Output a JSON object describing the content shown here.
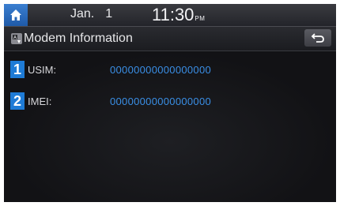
{
  "status_bar": {
    "month": "Jan.",
    "day": "1",
    "time": "11:30",
    "ampm": "PM",
    "home_icon": "home-icon"
  },
  "title_bar": {
    "title": "Modem Information",
    "title_icon": "modem-info-icon",
    "back_icon": "back-arrow-icon"
  },
  "items": [
    {
      "number": "1",
      "label": "USIM:",
      "value": "00000000000000000"
    },
    {
      "number": "2",
      "label": "IMEI:",
      "value": "00000000000000000"
    }
  ],
  "colors": {
    "accent": "#1e7bd6",
    "value_text": "#3a8fe6",
    "background": "#0e0e10"
  }
}
